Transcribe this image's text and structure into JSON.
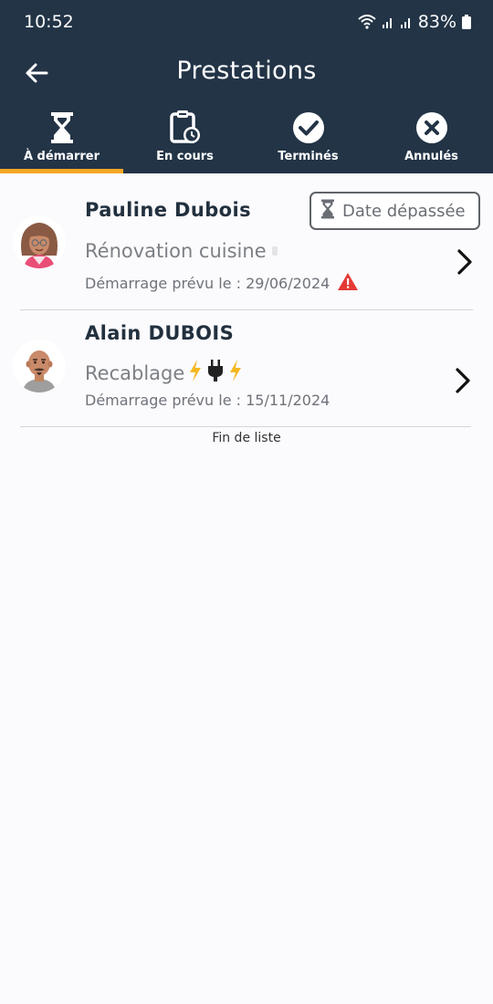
{
  "status": {
    "time": "10:52",
    "battery": "83%"
  },
  "header": {
    "title": "Prestations"
  },
  "tabs": [
    {
      "label": "À démarrer",
      "icon": "hourglass-icon",
      "active": true
    },
    {
      "label": "En cours",
      "icon": "clipboard-clock-icon",
      "active": false
    },
    {
      "label": "Terminés",
      "icon": "check-circle-icon",
      "active": false
    },
    {
      "label": "Annulés",
      "icon": "close-circle-icon",
      "active": false
    }
  ],
  "items": [
    {
      "client": "Pauline Dubois",
      "service": "Rénovation cuisine",
      "start_label": "Démarrage prévu le : 29/06/2024",
      "badge": "Date dépassée",
      "warning": true
    },
    {
      "client": "Alain DUBOIS",
      "service": "Recablage",
      "start_label": "Démarrage prévu le : 15/11/2024",
      "badge": "",
      "warning": false
    }
  ],
  "list_end": "Fin de liste",
  "colors": {
    "header_bg": "#233447",
    "tab_indicator": "#f5a623",
    "warning": "#e53935",
    "bolt": "#f5b820"
  }
}
